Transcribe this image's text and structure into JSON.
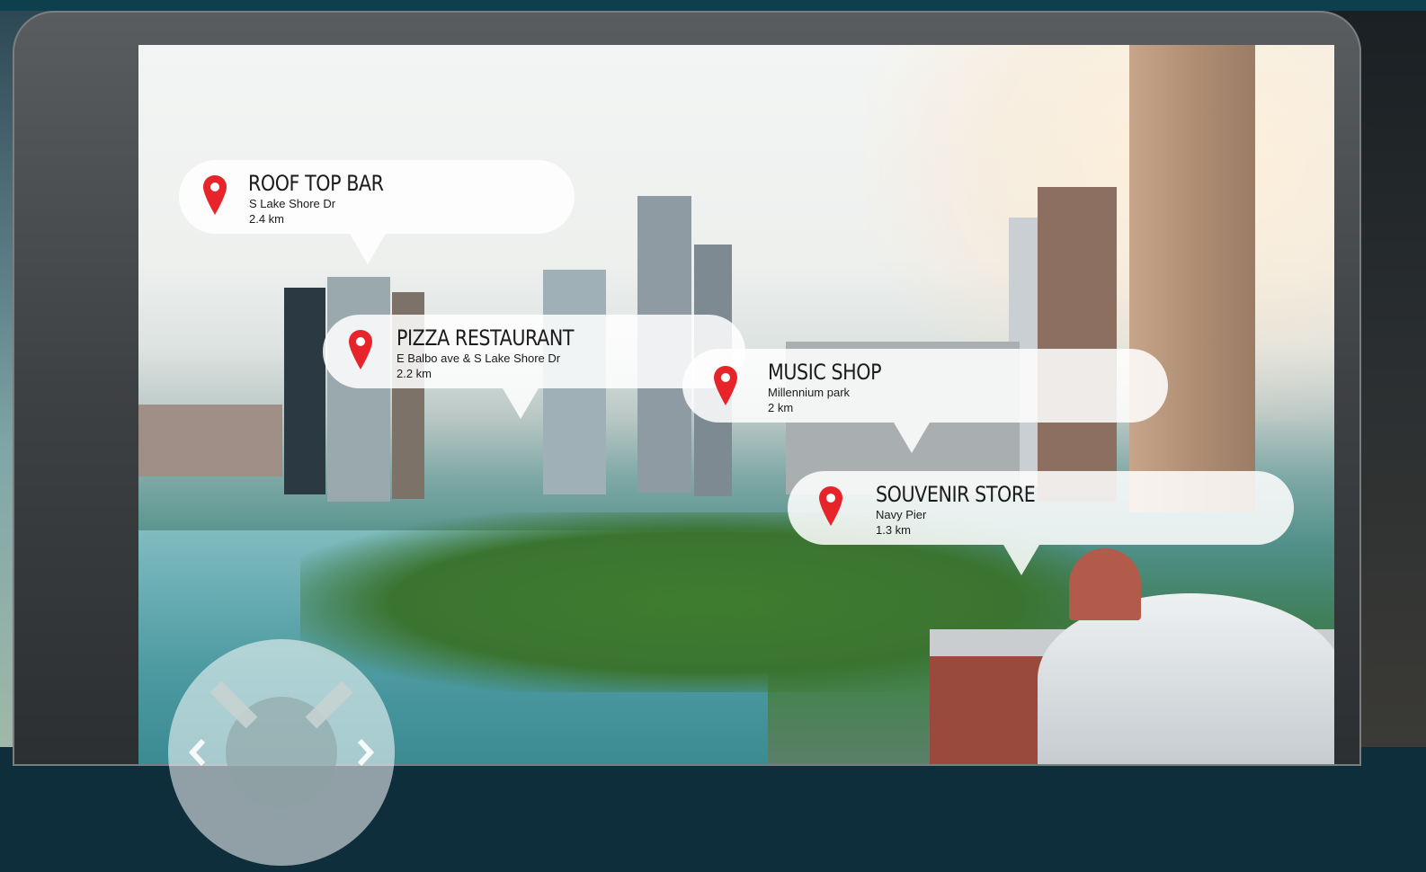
{
  "callouts": [
    {
      "title": "ROOF TOP BAR",
      "address": "S Lake Shore Dr",
      "distance": "2.4 km"
    },
    {
      "title": "PIZZA RESTAURANT",
      "address": "E Balbo ave & S Lake Shore Dr",
      "distance": "2.2 km"
    },
    {
      "title": "MUSIC SHOP",
      "address": "Millennium park",
      "distance": "2 km"
    },
    {
      "title": "SOUVENIR STORE",
      "address": "Navy Pier",
      "distance": "1.3 km"
    }
  ],
  "colors": {
    "pin": "#e8242b",
    "callout_bg": "#ffffff",
    "text": "#1b1b1b"
  },
  "icons": [
    "map-pin-icon",
    "nav-ring-icon",
    "chevron-left-icon",
    "chevron-right-icon"
  ]
}
